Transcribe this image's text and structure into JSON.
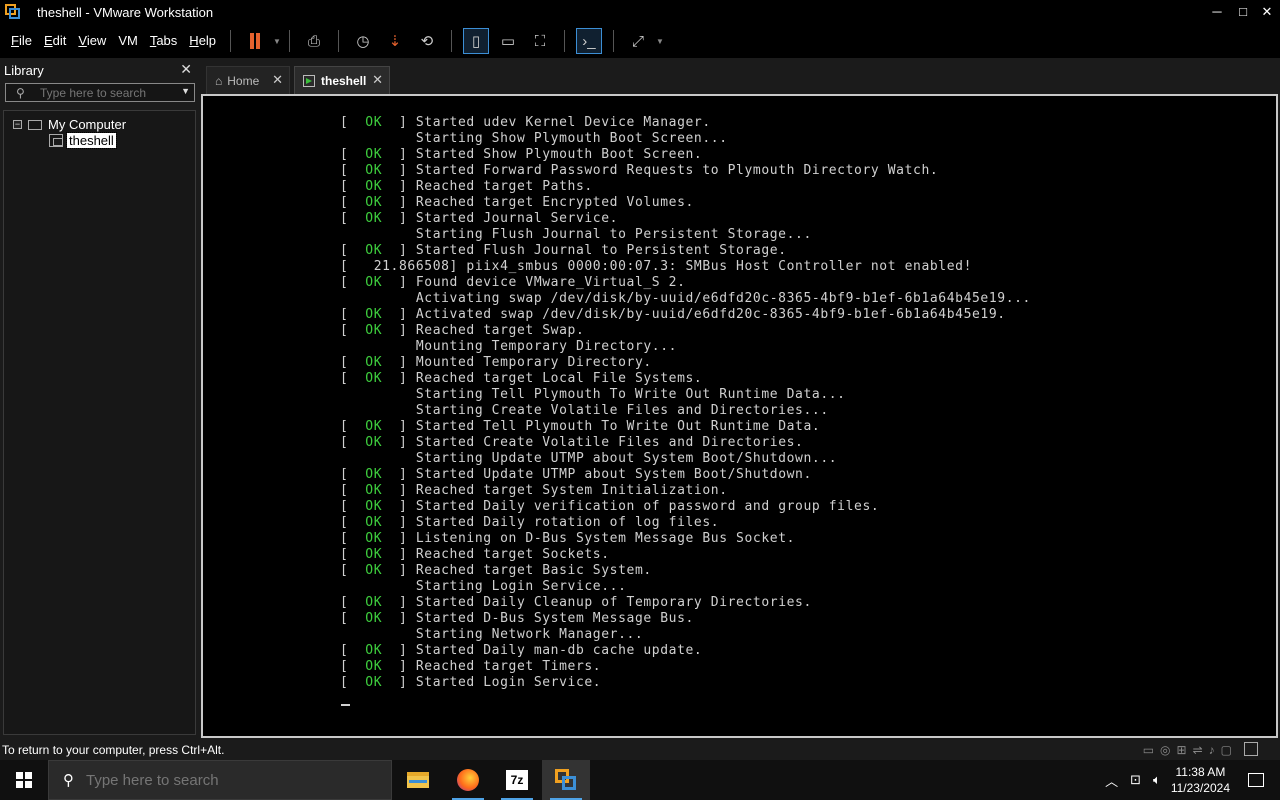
{
  "window": {
    "title": "theshell - VMware Workstation",
    "minimize": "─",
    "maximize": "□",
    "close": "✕"
  },
  "menu": [
    "File",
    "Edit",
    "View",
    "VM",
    "Tabs",
    "Help"
  ],
  "menu_underline": [
    "F",
    "E",
    "V",
    "M",
    "T",
    "H"
  ],
  "library": {
    "title": "Library",
    "search_placeholder": "Type here to search",
    "tree": {
      "root": "My Computer",
      "child": "theshell"
    }
  },
  "tabs": [
    {
      "label": "Home",
      "icon": "home-icon"
    },
    {
      "label": "theshell",
      "icon": "vm-running-icon"
    }
  ],
  "console": {
    "ok_text": "OK",
    "lines": [
      {
        "ok": true,
        "text": "Started udev Kernel Device Manager."
      },
      {
        "ok": false,
        "text": "Starting Show Plymouth Boot Screen..."
      },
      {
        "ok": true,
        "text": "Started Show Plymouth Boot Screen."
      },
      {
        "ok": true,
        "text": "Started Forward Password Requests to Plymouth Directory Watch."
      },
      {
        "ok": true,
        "text": "Reached target Paths."
      },
      {
        "ok": true,
        "text": "Reached target Encrypted Volumes."
      },
      {
        "ok": true,
        "text": "Started Journal Service."
      },
      {
        "ok": false,
        "text": "Starting Flush Journal to Persistent Storage..."
      },
      {
        "ok": true,
        "text": "Started Flush Journal to Persistent Storage."
      },
      {
        "raw": true,
        "text": "[   21.866508] piix4_smbus 0000:00:07.3: SMBus Host Controller not enabled!"
      },
      {
        "ok": true,
        "text": "Found device VMware_Virtual_S 2."
      },
      {
        "ok": false,
        "text": "Activating swap /dev/disk/by-uuid/e6dfd20c-8365-4bf9-b1ef-6b1a64b45e19..."
      },
      {
        "ok": true,
        "text": "Activated swap /dev/disk/by-uuid/e6dfd20c-8365-4bf9-b1ef-6b1a64b45e19."
      },
      {
        "ok": true,
        "text": "Reached target Swap."
      },
      {
        "ok": false,
        "text": "Mounting Temporary Directory..."
      },
      {
        "ok": true,
        "text": "Mounted Temporary Directory."
      },
      {
        "ok": true,
        "text": "Reached target Local File Systems."
      },
      {
        "ok": false,
        "text": "Starting Tell Plymouth To Write Out Runtime Data..."
      },
      {
        "ok": false,
        "text": "Starting Create Volatile Files and Directories..."
      },
      {
        "ok": true,
        "text": "Started Tell Plymouth To Write Out Runtime Data."
      },
      {
        "ok": true,
        "text": "Started Create Volatile Files and Directories."
      },
      {
        "ok": false,
        "text": "Starting Update UTMP about System Boot/Shutdown..."
      },
      {
        "ok": true,
        "text": "Started Update UTMP about System Boot/Shutdown."
      },
      {
        "ok": true,
        "text": "Reached target System Initialization."
      },
      {
        "ok": true,
        "text": "Started Daily verification of password and group files."
      },
      {
        "ok": true,
        "text": "Started Daily rotation of log files."
      },
      {
        "ok": true,
        "text": "Listening on D-Bus System Message Bus Socket."
      },
      {
        "ok": true,
        "text": "Reached target Sockets."
      },
      {
        "ok": true,
        "text": "Reached target Basic System."
      },
      {
        "ok": false,
        "text": "Starting Login Service..."
      },
      {
        "ok": true,
        "text": "Started Daily Cleanup of Temporary Directories."
      },
      {
        "ok": true,
        "text": "Started D-Bus System Message Bus."
      },
      {
        "ok": false,
        "text": "Starting Network Manager..."
      },
      {
        "ok": true,
        "text": "Started Daily man-db cache update."
      },
      {
        "ok": true,
        "text": "Reached target Timers."
      },
      {
        "ok": true,
        "text": "Started Login Service."
      }
    ]
  },
  "status": {
    "text": "To return to your computer, press Ctrl+Alt."
  },
  "taskbar": {
    "search_placeholder": "Type here to search",
    "apps": [
      "file-explorer-icon",
      "firefox-icon",
      "7zip-icon",
      "vmware-icon"
    ],
    "sevenzip_label": "7z",
    "time": "11:38 AM",
    "date": "11/23/2024"
  },
  "colors": {
    "ok_green": "#3ecf3e",
    "accent_blue": "#3c8fd6",
    "pause_orange": "#e6622e"
  }
}
